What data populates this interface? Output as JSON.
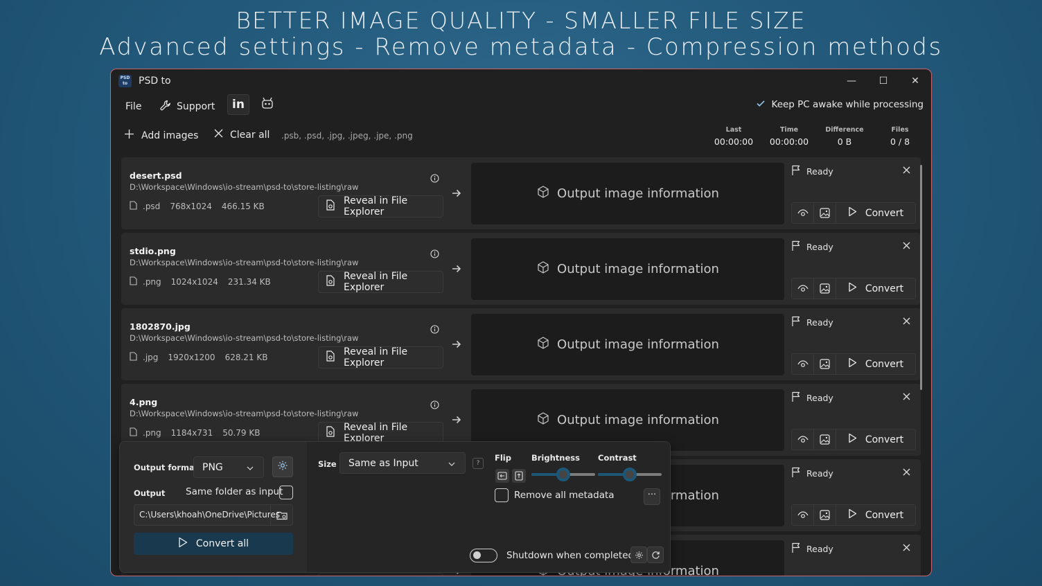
{
  "headline": {
    "line1": "BETTER IMAGE QUALITY - SMALLER FILE SIZE",
    "line2": "Advanced settings - Remove metadata - Compression methods"
  },
  "window": {
    "title": "PSD to",
    "icon_text": "PSD to",
    "controls": {
      "minimize": "—",
      "maximize": "☐",
      "close": "✕"
    }
  },
  "menu": {
    "file": "File",
    "support": "Support",
    "linkedin_icon": "in",
    "keep_awake": {
      "label": "Keep PC awake while processing",
      "checked": true
    }
  },
  "toolbar": {
    "add_images": "Add images",
    "clear_all": "Clear all",
    "extensions": ".psb, .psd, .jpg, .jpeg, .jpe, .png",
    "stats": [
      {
        "label": "Last",
        "value": "00:00:00"
      },
      {
        "label": "Time",
        "value": "00:00:00"
      },
      {
        "label": "Difference",
        "value": "0 B"
      },
      {
        "label": "Files",
        "value": "0 / 8"
      }
    ]
  },
  "files": [
    {
      "name": "desert.psd",
      "path": "D:\\Workspace\\Windows\\io-stream\\psd-to\\store-listing\\raw",
      "ext": ".psd",
      "dims": "768x1024",
      "size": "466.15 KB",
      "reveal": "Reveal in File Explorer",
      "output": "Output image information",
      "status": "Ready",
      "convert": "Convert"
    },
    {
      "name": "stdio.png",
      "path": "D:\\Workspace\\Windows\\io-stream\\psd-to\\store-listing\\raw",
      "ext": ".png",
      "dims": "1024x1024",
      "size": "231.34 KB",
      "reveal": "Reveal in File Explorer",
      "output": "Output image information",
      "status": "Ready",
      "convert": "Convert"
    },
    {
      "name": "1802870.jpg",
      "path": "D:\\Workspace\\Windows\\io-stream\\psd-to\\store-listing\\raw",
      "ext": ".jpg",
      "dims": "1920x1200",
      "size": "628.21 KB",
      "reveal": "Reveal in File Explorer",
      "output": "Output image information",
      "status": "Ready",
      "convert": "Convert"
    },
    {
      "name": "4.png",
      "path": "D:\\Workspace\\Windows\\io-stream\\psd-to\\store-listing\\raw",
      "ext": ".png",
      "dims": "1184x731",
      "size": "50.79 KB",
      "reveal": "Reveal in File Explorer",
      "output": "Output image information",
      "status": "Ready",
      "convert": "Convert"
    },
    {
      "name": "",
      "path": "",
      "ext": "",
      "dims": "",
      "size": "",
      "reveal": "",
      "output": "Output image information",
      "status": "Ready",
      "convert": "Convert"
    },
    {
      "name": "",
      "path": "",
      "ext": "",
      "dims": "",
      "size": "",
      "reveal": "",
      "output": "Output image information",
      "status": "Ready",
      "convert": ""
    }
  ],
  "panel": {
    "output_format_label": "Output format",
    "output_format_value": "PNG",
    "output_label": "Output",
    "same_folder_label": "Same folder as input",
    "output_path": "C:\\Users\\khoah\\OneDrive\\Pictures",
    "convert_all": "Convert all",
    "size_label": "Size",
    "size_value": "Same as Input",
    "help": "?",
    "flip_label": "Flip",
    "brightness_label": "Brightness",
    "brightness_level": 0.5,
    "contrast_label": "Contrast",
    "contrast_level": 0.5,
    "remove_metadata": "Remove all metadata",
    "more": "···",
    "shutdown_label": "Shutdown when completed"
  },
  "colors": {
    "background": "#235a7c",
    "window": "#202020",
    "accent": "#1e5677",
    "window_border": "#c7646c"
  }
}
